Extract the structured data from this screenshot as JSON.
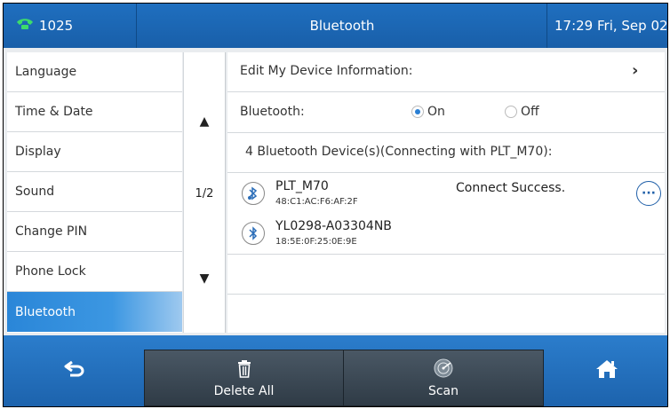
{
  "status_bar": {
    "line_number": "1025",
    "title": "Bluetooth",
    "clock": "17:29 Fri, Sep 02"
  },
  "menu": {
    "items": [
      {
        "label": "Language"
      },
      {
        "label": "Time & Date"
      },
      {
        "label": "Display"
      },
      {
        "label": "Sound"
      },
      {
        "label": "Change PIN"
      },
      {
        "label": "Phone Lock"
      },
      {
        "label": "Bluetooth"
      }
    ],
    "active_index": 6
  },
  "pager": {
    "page": "1/2",
    "up_icon": "triangle-up-icon",
    "down_icon": "triangle-down-icon"
  },
  "content": {
    "edit_device_label": "Edit My Device Information:",
    "bluetooth_label": "Bluetooth:",
    "on_label": "On",
    "off_label": "Off",
    "bluetooth_state": "On",
    "device_count_label": "4 Bluetooth Device(s)(Connecting with PLT_M70):",
    "devices": [
      {
        "name": "PLT_M70",
        "mac": "48:C1:AC:F6:AF:2F",
        "status": "Connect Success."
      },
      {
        "name": "YL0298-A03304NB",
        "mac": "18:5E:0F:25:0E:9E",
        "status": ""
      }
    ]
  },
  "softkeys": {
    "back_icon": "back-arrow-icon",
    "delete_all": "Delete All",
    "delete_icon": "trash-icon",
    "scan": "Scan",
    "scan_icon": "radar-icon",
    "home_icon": "home-icon"
  },
  "colors": {
    "accent": "#1f6fbf",
    "active_menu": "#2a86d8",
    "softkey_dark": "#3a4753"
  }
}
